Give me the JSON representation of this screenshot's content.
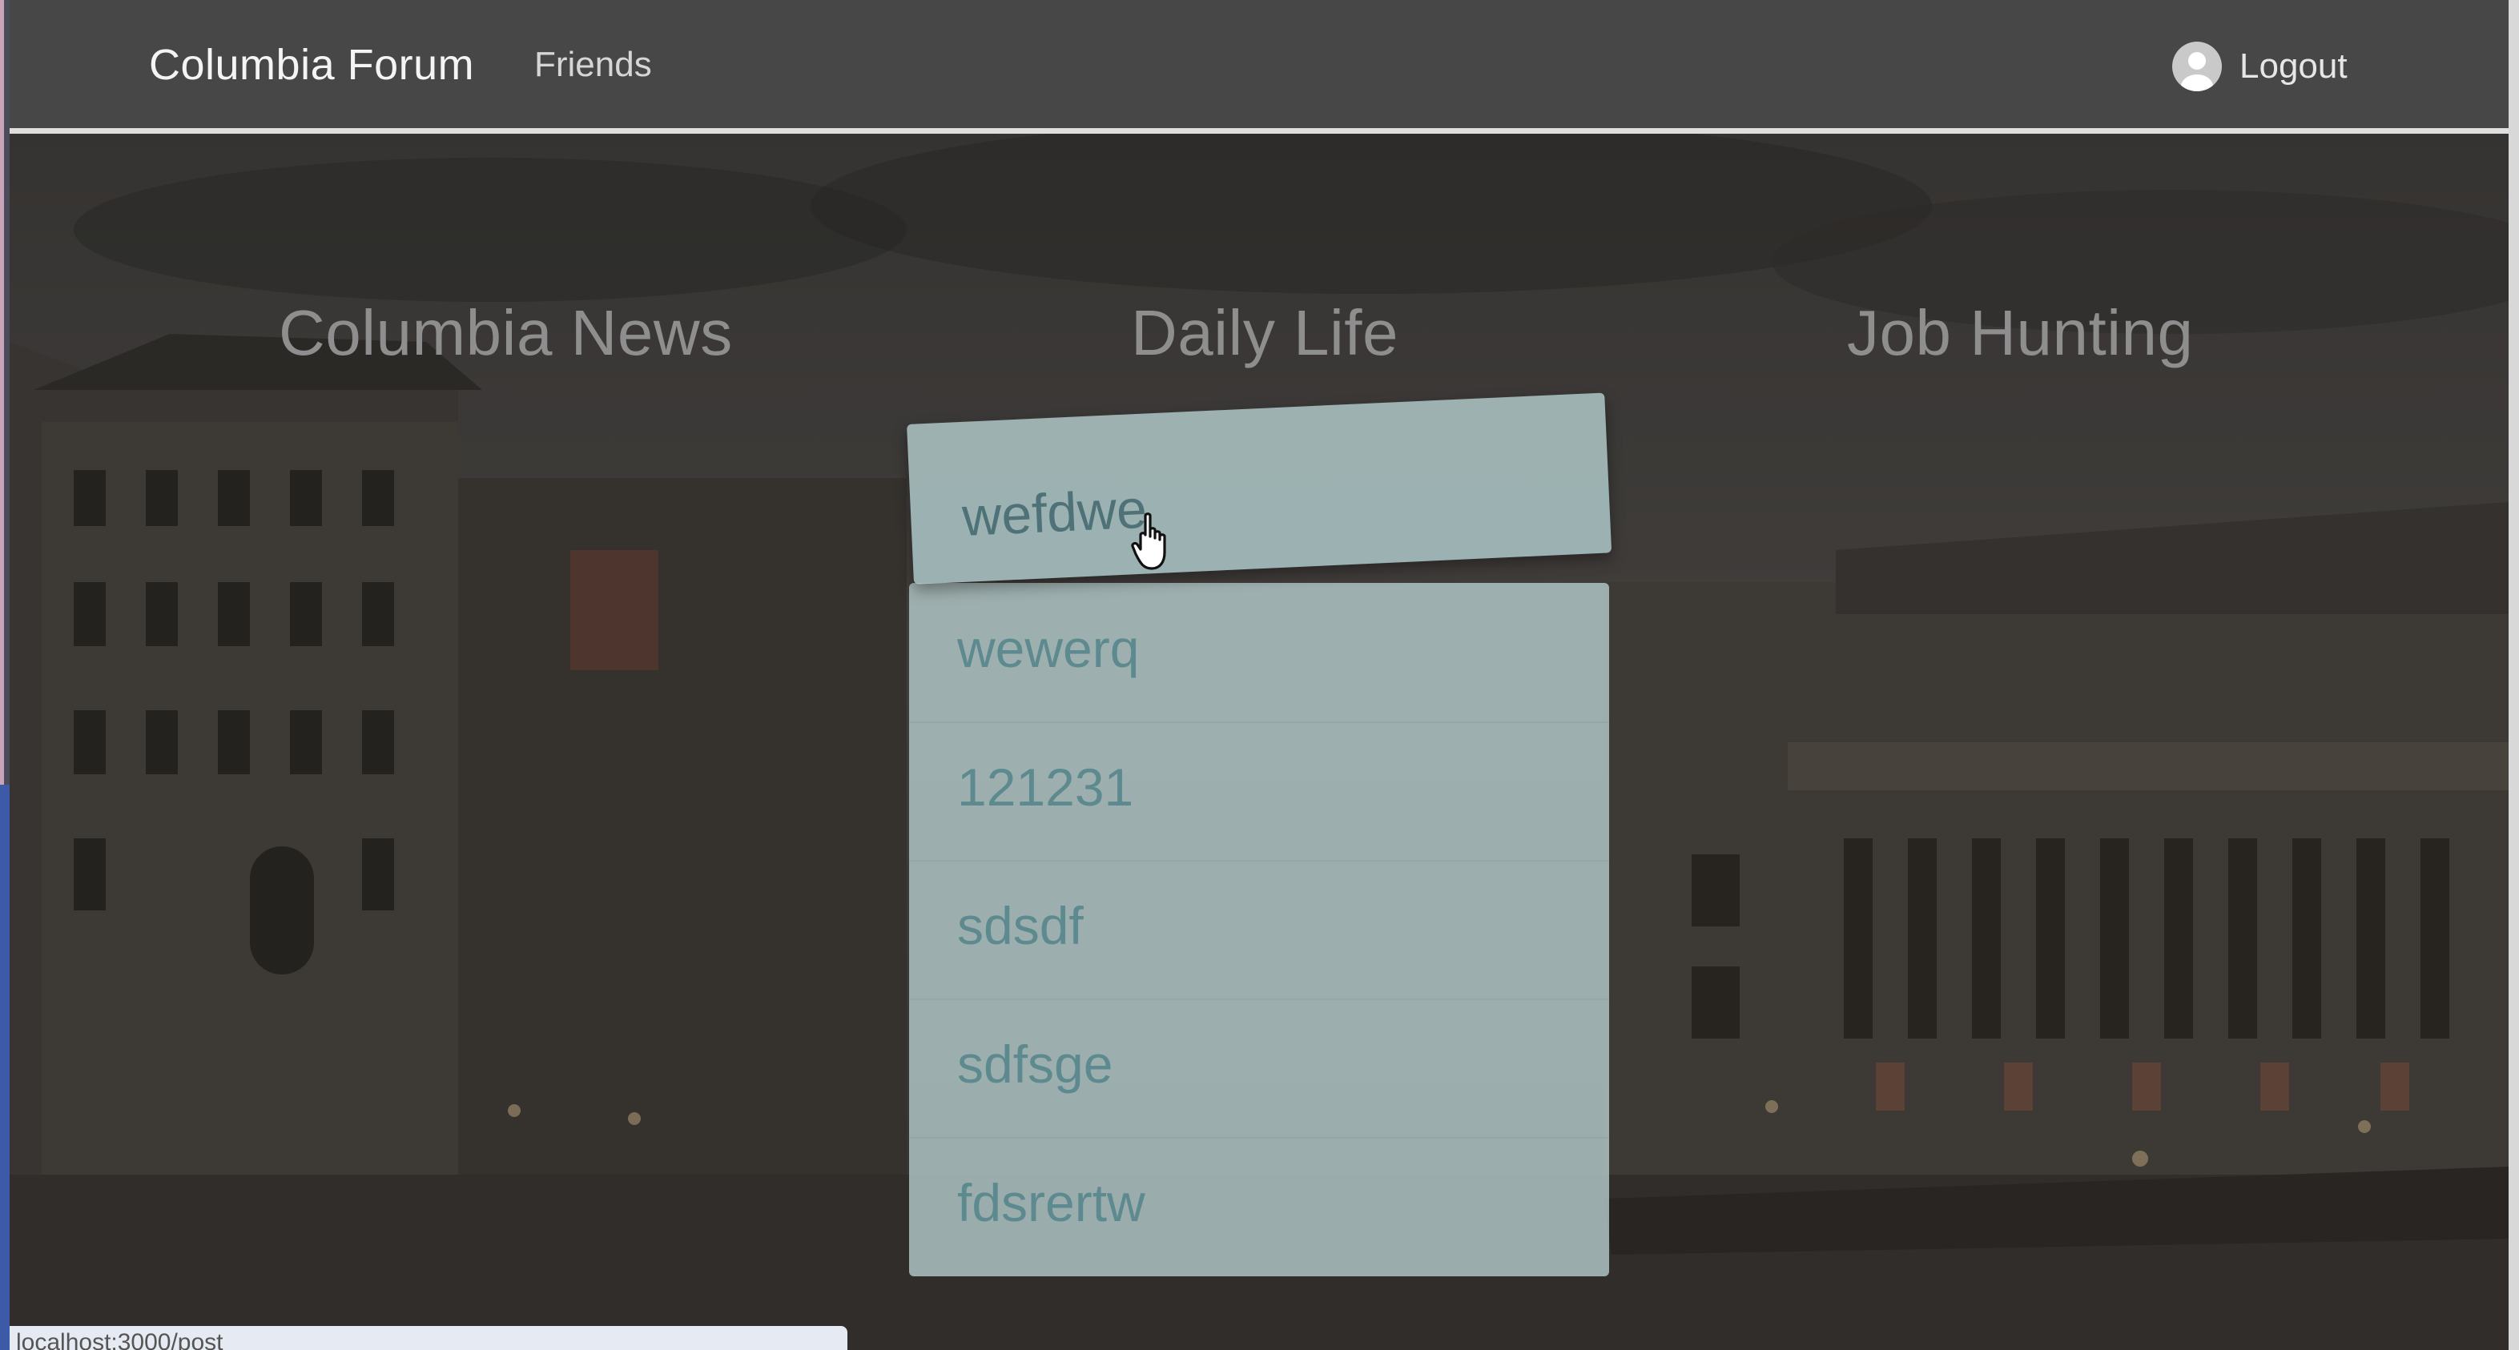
{
  "navbar": {
    "brand": "Columbia Forum",
    "links": [
      {
        "label": "Friends"
      }
    ],
    "logout_label": "Logout"
  },
  "categories": [
    {
      "label": "Columbia News"
    },
    {
      "label": "Daily Life"
    },
    {
      "label": "Job Hunting"
    }
  ],
  "posts": [
    {
      "title": "wefdwe",
      "hovered": true
    },
    {
      "title": "wewerq"
    },
    {
      "title": "121231"
    },
    {
      "title": "sdsdf"
    },
    {
      "title": "sdfsge"
    },
    {
      "title": "fdsrertw"
    }
  ],
  "status_bar": {
    "url": "localhost:3000/post"
  },
  "colors": {
    "navbar_bg": "#474747",
    "post_text": "#5d8a8f",
    "list_bg": "#b2c8c8"
  },
  "icons": [
    "user-avatar-icon",
    "hand-pointer-cursor-icon"
  ]
}
